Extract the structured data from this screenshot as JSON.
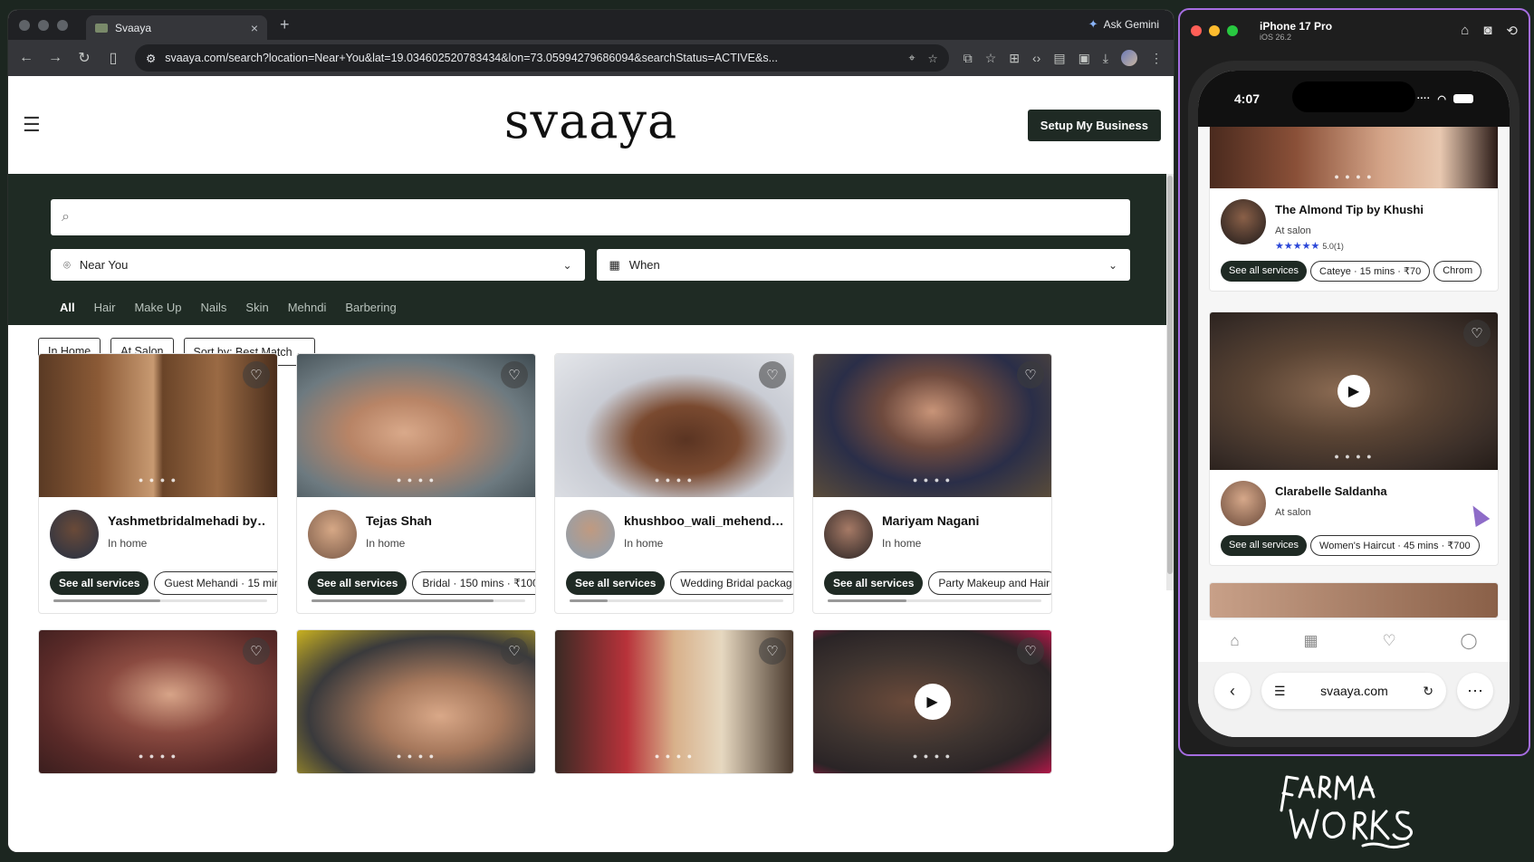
{
  "browser": {
    "tab_title": "Svaaya",
    "tab_close": "×",
    "new_tab": "+",
    "ask_gemini": "Ask Gemini",
    "url": "svaaya.com/search?location=Near+You&lat=19.034602520783434&lon=73.05994279686094&searchStatus=ACTIVE&s..."
  },
  "header": {
    "logo": "svaaya",
    "setup_button": "Setup My Business"
  },
  "search": {
    "placeholder": "",
    "location": "Near You",
    "when": "When"
  },
  "categories": [
    "All",
    "Hair",
    "Make Up",
    "Nails",
    "Skin",
    "Mehndi",
    "Barbering"
  ],
  "filters": [
    "In Home",
    "At Salon",
    "Sort by: Best Match"
  ],
  "cards": [
    {
      "name": "Yashmetbridalmehadi by ...",
      "location": "In home",
      "see_all": "See all services",
      "service": "Guest Mehandi · 15 min"
    },
    {
      "name": "Tejas Shah",
      "location": "In home",
      "see_all": "See all services",
      "service": "Bridal · 150 mins · ₹100"
    },
    {
      "name": "khushboo_wali_mehendi b...",
      "location": "In home",
      "see_all": "See all services",
      "service": "Wedding Bridal packag"
    },
    {
      "name": "Mariyam Nagani",
      "location": "In home",
      "see_all": "See all services",
      "service": "Party Makeup and Hair"
    }
  ],
  "simulator": {
    "device": "iPhone 17 Pro",
    "os": "iOS 26.2",
    "time": "4:07",
    "cards": [
      {
        "name": "The Almond Tip by Khushi",
        "location": "At salon",
        "rating": "5.0(1)",
        "see_all": "See all services",
        "services": [
          "Cateye · 15 mins · ₹70",
          "Chrom"
        ]
      },
      {
        "name": "Clarabelle Saldanha",
        "location": "At salon",
        "see_all": "See all services",
        "services": [
          "Women's Haircut · 45 mins · ₹700"
        ]
      }
    ],
    "url": "svaaya.com"
  },
  "icons": {
    "search": "search-icon",
    "location": "pin-icon",
    "calendar": "calendar-icon",
    "heart": "heart-icon",
    "play": "play-icon"
  },
  "colors": {
    "brand_dark": "#1f2a24",
    "page_bg": "#1c2620",
    "rating_star": "#2a46d8",
    "sim_border": "#a56de0"
  }
}
